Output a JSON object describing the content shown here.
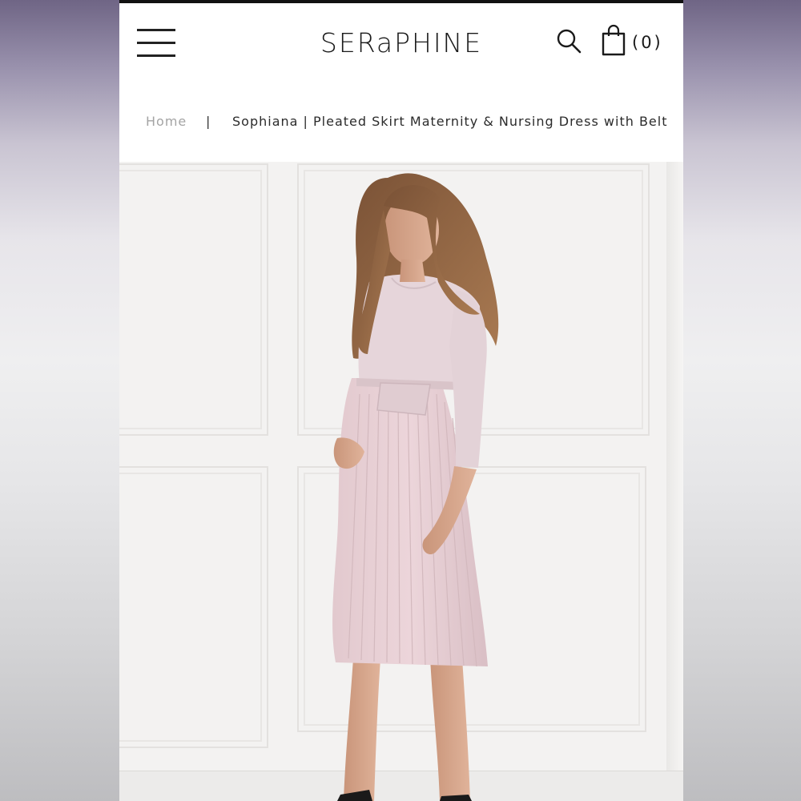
{
  "brand": {
    "logo_text": "SERaPHINE"
  },
  "header": {
    "cart_count": "(0)"
  },
  "breadcrumb": {
    "home": "Home",
    "separator": "|",
    "current": "Sophiana | Pleated Skirt Maternity & Nursing Dress with Belt"
  },
  "icons": {
    "menu": "hamburger-menu-icon",
    "search": "search-icon",
    "bag": "shopping-bag-icon"
  },
  "colors": {
    "dress": "#e4d3d8",
    "dress_skirt": "#e8cfd4",
    "text": "#1a1a1a",
    "muted": "#a4a4a4"
  }
}
